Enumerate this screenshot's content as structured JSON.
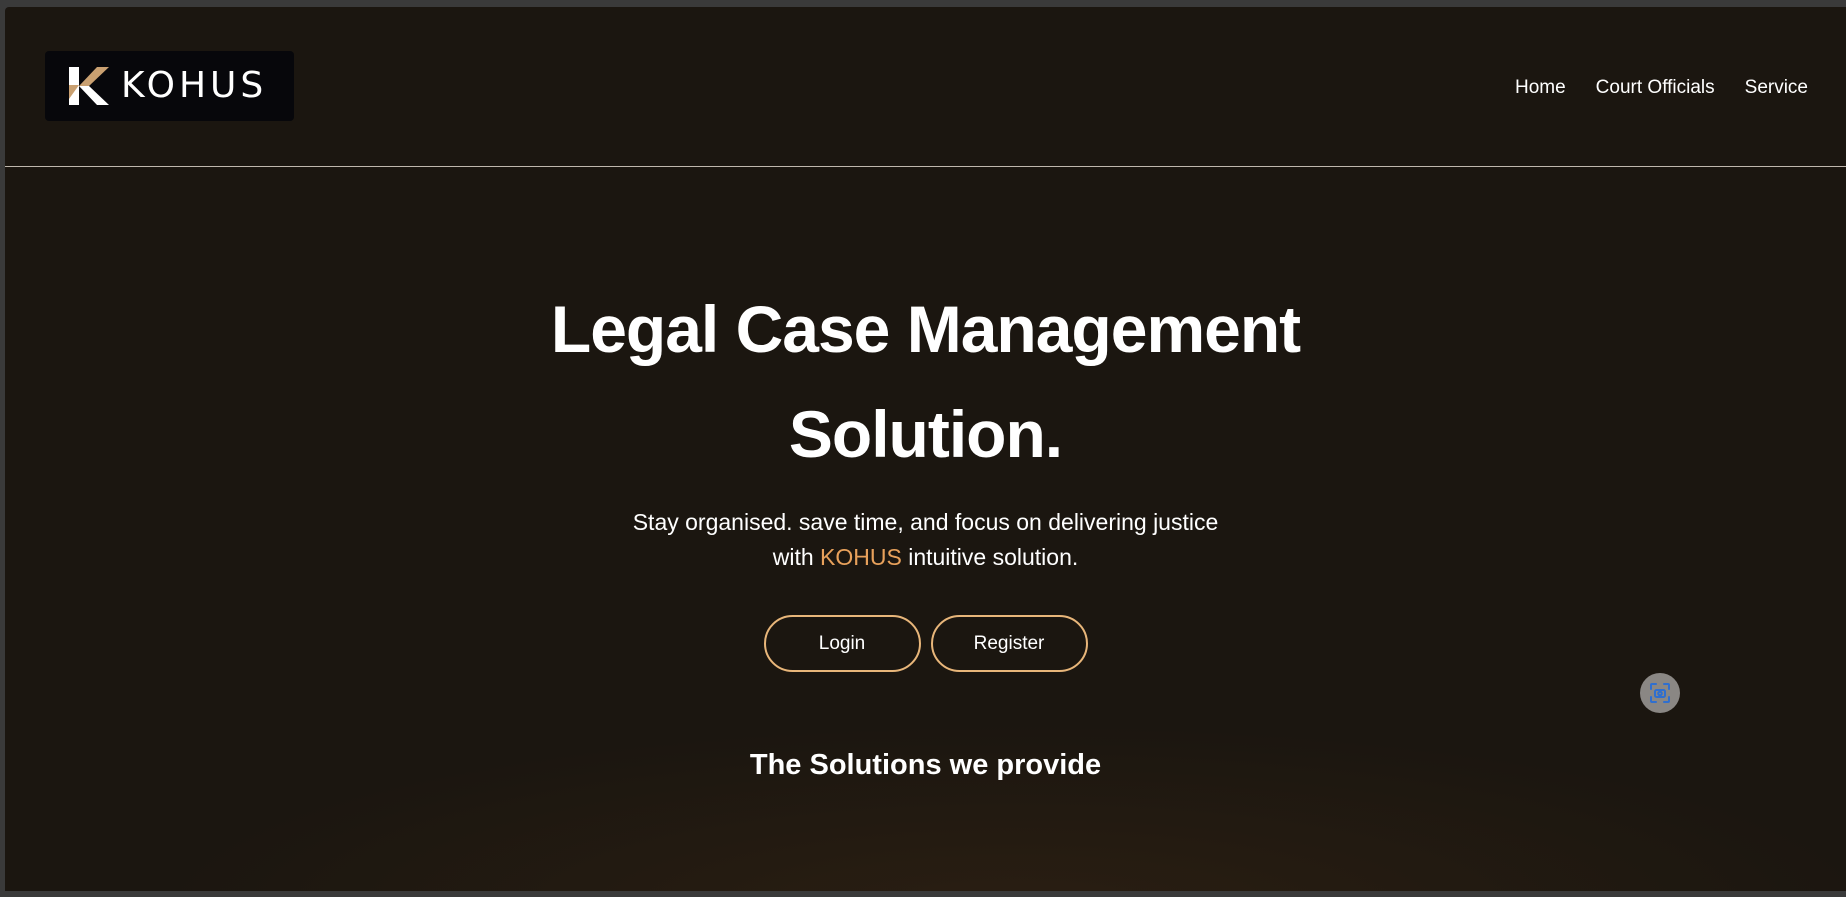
{
  "logo": {
    "text": "KOHUS",
    "colors": {
      "mark_gold": "#c9a071",
      "mark_white": "#ffffff",
      "background": "#07070b"
    }
  },
  "nav": {
    "items": [
      {
        "label": "Home"
      },
      {
        "label": "Court Officials"
      },
      {
        "label": "Service"
      }
    ]
  },
  "hero": {
    "title": "Legal Case Management Solution.",
    "subtitle_line1": "Stay organised. save time, and focus on delivering justice",
    "subtitle_line2_prefix": "with ",
    "subtitle_brand": "KOHUS",
    "subtitle_line2_suffix": " intuitive solution.",
    "login_label": "Login",
    "register_label": "Register"
  },
  "solutions": {
    "title": "The Solutions we provide"
  },
  "floating_button": {
    "icon": "screen-capture-icon"
  },
  "colors": {
    "background": "#1b1610",
    "accent": "#e8a15b",
    "button_border": "#e8b67a",
    "text": "#ffffff"
  }
}
